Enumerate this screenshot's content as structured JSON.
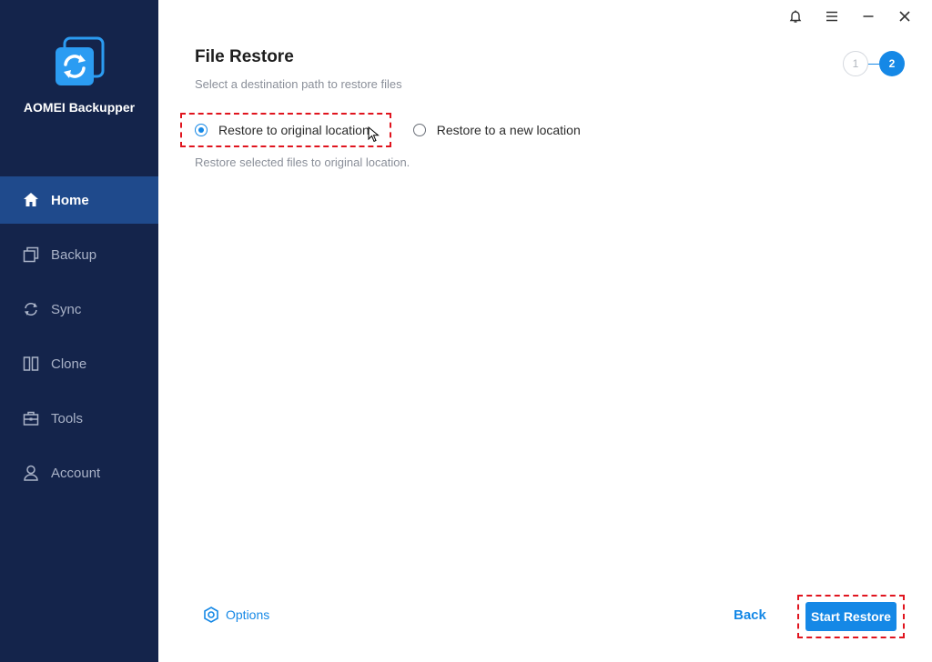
{
  "app": {
    "name": "AOMEI Backupper"
  },
  "sidebar": {
    "items": [
      {
        "label": "Home",
        "icon": "home-icon",
        "active": true
      },
      {
        "label": "Backup",
        "icon": "backup-icon",
        "active": false
      },
      {
        "label": "Sync",
        "icon": "sync-icon",
        "active": false
      },
      {
        "label": "Clone",
        "icon": "clone-icon",
        "active": false
      },
      {
        "label": "Tools",
        "icon": "tools-icon",
        "active": false
      },
      {
        "label": "Account",
        "icon": "account-icon",
        "active": false
      }
    ]
  },
  "window_controls": [
    "bell-icon",
    "menu-icon",
    "minimize-icon",
    "close-icon"
  ],
  "header": {
    "title": "File Restore",
    "subtitle": "Select a destination path to restore files"
  },
  "steps": [
    {
      "label": "1",
      "active": false
    },
    {
      "label": "2",
      "active": true
    }
  ],
  "restore_options": {
    "original": {
      "label": "Restore to original location",
      "selected": true
    },
    "new": {
      "label": "Restore to a new location",
      "selected": false
    },
    "description": "Restore selected files to original location."
  },
  "footer": {
    "options_label": "Options",
    "back_label": "Back",
    "start_label": "Start Restore"
  },
  "colors": {
    "sidebar_bg": "#14244b",
    "sidebar_active": "#1f4a8c",
    "accent": "#1588e6",
    "highlight": "#e0141e"
  }
}
